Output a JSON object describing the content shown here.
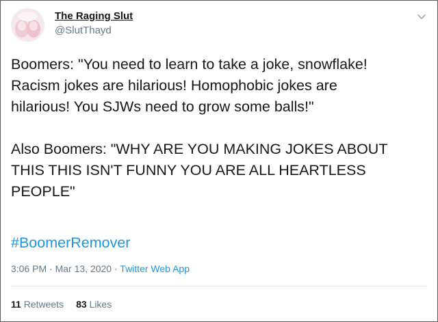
{
  "user": {
    "display_name": "The Raging Slut",
    "handle": "@SlutThayd",
    "avatar_icon": "avatar-photo"
  },
  "tweet": {
    "paragraph_1_lines": [
      "Boomers: \"You need to learn to take a joke, snowflake!",
      "Racism jokes are hilarious! Homophobic jokes are",
      "hilarious! You SJWs need to grow some balls!\""
    ],
    "paragraph_2_lines": [
      "Also Boomers: \"WHY ARE YOU MAKING JOKES ABOUT",
      "THIS THIS ISN'T FUNNY YOU ARE ALL HEARTLESS",
      "PEOPLE\""
    ],
    "hashtag": "#BoomerRemover"
  },
  "meta": {
    "time": "3:06 PM",
    "separator": "·",
    "date": "Mar 13, 2020",
    "source": "Twitter Web App"
  },
  "stats": {
    "retweets_count": "11",
    "retweets_label": "Retweets",
    "likes_count": "83",
    "likes_label": "Likes"
  },
  "icons": {
    "menu": "chevron-down-icon"
  },
  "colors": {
    "link": "#1b95e0",
    "secondary_text": "#657786",
    "primary_text": "#14171a",
    "divider": "#e1e8ed"
  }
}
